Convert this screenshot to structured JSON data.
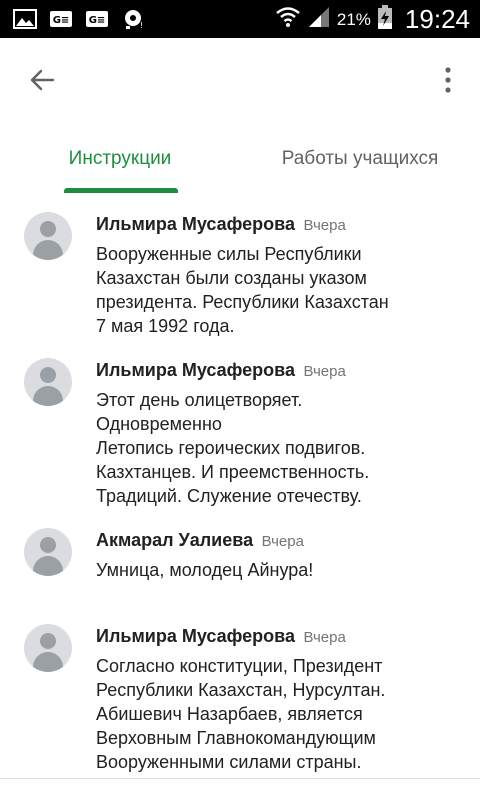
{
  "status_bar": {
    "battery_percent": "21%",
    "time": "19:24",
    "icons": [
      "image-icon",
      "sim-ge-icon",
      "sim-ge-icon",
      "sync-icon",
      "wifi-icon",
      "signal-icon",
      "battery-icon"
    ]
  },
  "app_bar": {
    "back_icon": "arrow-back-icon",
    "more_icon": "more-vert-icon"
  },
  "tabs": [
    {
      "label": "Инструкции",
      "active": true
    },
    {
      "label": "Работы учащихся",
      "active": false
    }
  ],
  "colors": {
    "accent": "#1e8e3e",
    "inactive_tab": "#5f6368",
    "status_bar": "#000000"
  },
  "comments": [
    {
      "author": "Ильмира Мусаферова",
      "time": "Вчера",
      "lines": [
        "Вооруженные силы Республики",
        "Казахстан были  созданы указом",
        "президента.  Республики Казахстан",
        "7 мая 1992  года."
      ]
    },
    {
      "author": "Ильмира Мусаферова",
      "time": "Вчера",
      "lines": [
        "Этот день олицетворяет.",
        "Одновременно",
        "Летопись героических  подвигов.",
        "Казхтанцев. И  преемственность.",
        "Традиций. Служение отечеству."
      ]
    },
    {
      "author": "Акмарал Уалиева",
      "time": "Вчера",
      "lines": [
        "Умница, молодец Айнура!"
      ]
    },
    {
      "author": "Ильмира Мусаферова",
      "time": "Вчера",
      "lines": [
        "Согласно конституции, Президент",
        "Республики Казахстан,  Нурсултан.",
        "Абишевич Назарбаев, является",
        "Верховным Главнокомандующим",
        "Вооруженными силами страны."
      ]
    }
  ]
}
